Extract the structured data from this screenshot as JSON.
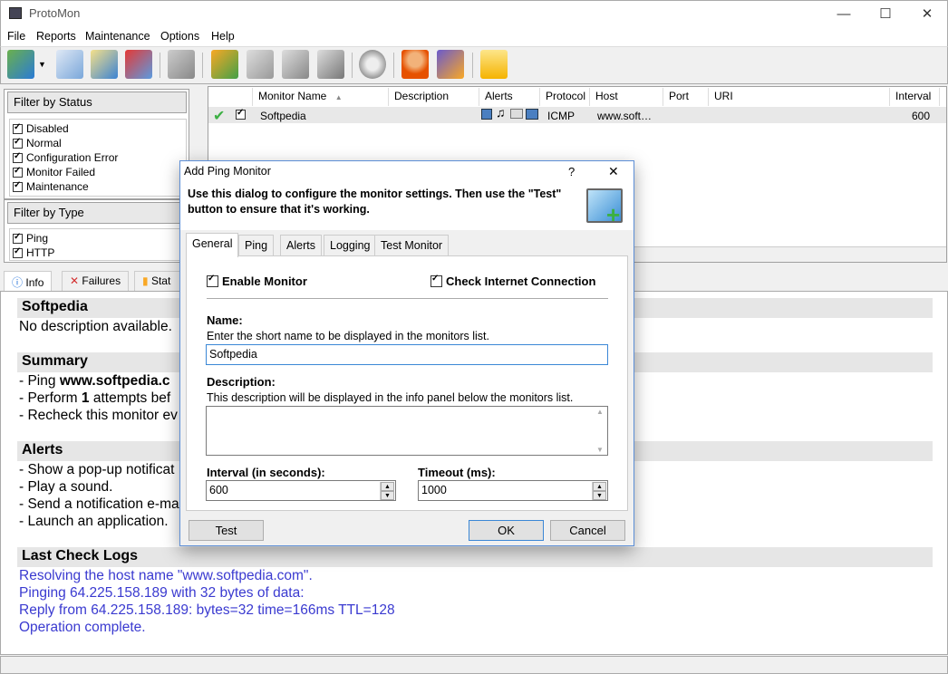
{
  "window": {
    "title": "ProtoMon",
    "min_glyph": "—",
    "max_glyph": "☐",
    "close_glyph": "✕"
  },
  "menu": [
    "File",
    "Reports",
    "Maintenance",
    "Options",
    "Help"
  ],
  "toolbar_icons": [
    "add-monitor-icon",
    "dropdown-arrow-icon",
    "copy-monitor-icon",
    "edit-monitor-icon",
    "delete-monitor-icon",
    "check-now-icon",
    "add-group-icon",
    "copy-group-icon",
    "edit-group-icon",
    "delete-group-icon",
    "settings-gear-icon",
    "support-person-icon",
    "help-book-icon",
    "lock-icon"
  ],
  "filter_status": {
    "title": "Filter by Status",
    "items": [
      "Disabled",
      "Normal",
      "Configuration Error",
      "Monitor Failed",
      "Maintenance"
    ]
  },
  "filter_type": {
    "title": "Filter by Type",
    "items": [
      "Ping",
      "HTTP"
    ]
  },
  "list": {
    "columns": [
      "Monitor Name",
      "Description",
      "Alerts",
      "Protocol",
      "Host",
      "Port",
      "URI",
      "Interval"
    ],
    "sort_glyph": "▲",
    "row": {
      "name": "Softpedia",
      "description": "",
      "protocol": "ICMP",
      "host": "www.soft…",
      "port": "",
      "uri": "",
      "interval": "600"
    }
  },
  "info_tabs": [
    "Info",
    "Failures",
    "Stat"
  ],
  "info": {
    "name_heading": "Softpedia",
    "description": "No description available.",
    "summary_heading": "Summary",
    "summary": {
      "line1_prefix": "- Ping ",
      "line1_bold": "www.softpedia.c",
      "line2_prefix": "- Perform ",
      "line2_bold": "1",
      "line2_rest": " attempts bef",
      "line3": "- Recheck this monitor ev"
    },
    "alerts_heading": "Alerts",
    "alerts": [
      "- Show a pop-up notificat",
      "- Play a sound.",
      "- Send a notification e-ma",
      "- Launch an application."
    ],
    "logs_heading": "Last Check Logs",
    "logs": [
      "Resolving the host name \"www.softpedia.com\".",
      "Pinging 64.225.158.189 with 32 bytes of data:",
      "Reply from 64.225.158.189: bytes=32 time=166ms TTL=128",
      "Operation complete."
    ]
  },
  "dialog": {
    "title": "Add Ping Monitor",
    "help_glyph": "?",
    "close_glyph": "✕",
    "intro": "Use this dialog to configure the monitor settings. Then use the \"Test\" button to ensure that it's working.",
    "tabs": [
      "General",
      "Ping",
      "Alerts",
      "Logging",
      "Test Monitor"
    ],
    "enable_monitor": "Enable Monitor",
    "check_internet": "Check Internet Connection",
    "name_label": "Name:",
    "name_hint": "Enter the short name to be displayed in the monitors list.",
    "name_value": "Softpedia",
    "desc_label": "Description:",
    "desc_hint": "This description will be displayed in the info panel below the monitors list.",
    "desc_value": "",
    "interval_label": "Interval (in seconds):",
    "interval_value": "600",
    "timeout_label": "Timeout (ms):",
    "timeout_value": "1000",
    "test_button": "Test",
    "ok_button": "OK",
    "cancel_button": "Cancel"
  }
}
